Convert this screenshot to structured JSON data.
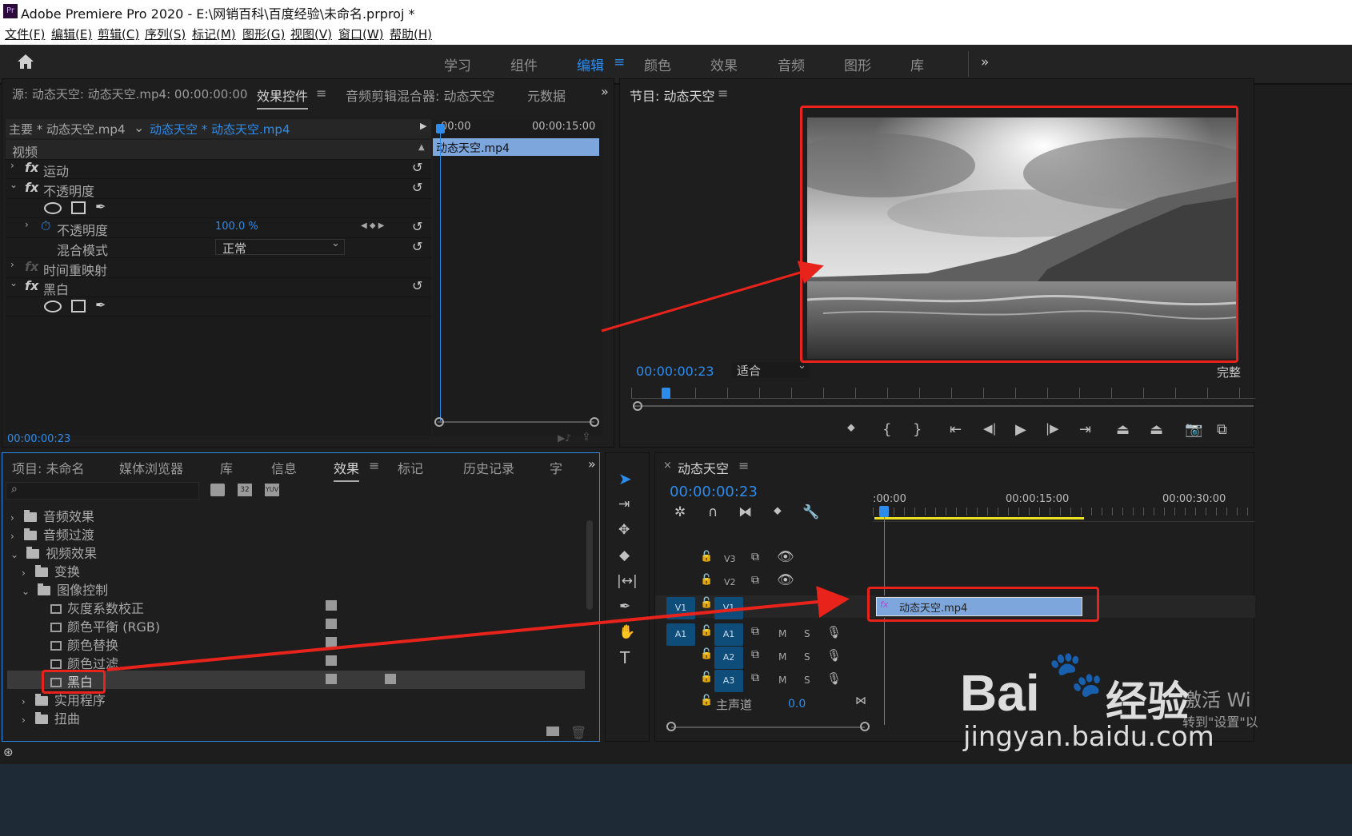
{
  "app": {
    "title": "Adobe Premiere Pro 2020 - E:\\网销百科\\百度经验\\未命名.prproj *",
    "pr_badge": "Pr"
  },
  "menu": [
    "文件(F)",
    "编辑(E)",
    "剪辑(C)",
    "序列(S)",
    "标记(M)",
    "图形(G)",
    "视图(V)",
    "窗口(W)",
    "帮助(H)"
  ],
  "workspaces": [
    "学习",
    "组件",
    "编辑",
    "颜色",
    "效果",
    "音频",
    "图形",
    "库"
  ],
  "active_workspace": "编辑",
  "source_panel": {
    "tabs": [
      "源: 动态天空: 动态天空.mp4: 00:00:00:00",
      "效果控件",
      "音频剪辑混合器: 动态天空",
      "元数据"
    ],
    "clip_master": "主要 * 动态天空.mp4",
    "clip_seq": "动态天空 * 动态天空.mp4",
    "section": "视频",
    "effects": [
      {
        "name": "运动"
      },
      {
        "name": "不透明度"
      },
      {
        "name": "不透明度",
        "value": "100.0 %"
      },
      {
        "name": "混合模式",
        "value": "正常"
      },
      {
        "name": "时间重映射"
      },
      {
        "name": "黑白"
      }
    ],
    "ruler": {
      "start": "00:00",
      "mid": "00:00:15:00"
    },
    "clip_label": "动态天空.mp4",
    "timecode": "00:00:00:23"
  },
  "program_panel": {
    "title": "节目: 动态天空",
    "timecode": "00:00:00:23",
    "fit": "适合",
    "quality": "完整"
  },
  "project_panel": {
    "tabs": [
      "项目: 未命名",
      "媒体浏览器",
      "库",
      "信息",
      "效果",
      "标记",
      "历史记录",
      "字"
    ],
    "tree": [
      {
        "label": "音频效果",
        "level": 0,
        "open": false
      },
      {
        "label": "音频过渡",
        "level": 0,
        "open": false
      },
      {
        "label": "视频效果",
        "level": 0,
        "open": true
      },
      {
        "label": "变换",
        "level": 1,
        "open": false
      },
      {
        "label": "图像控制",
        "level": 1,
        "open": true
      },
      {
        "label": "灰度系数校正",
        "level": 2
      },
      {
        "label": "颜色平衡 (RGB)",
        "level": 2
      },
      {
        "label": "颜色替换",
        "level": 2
      },
      {
        "label": "颜色过滤",
        "level": 2
      },
      {
        "label": "黑白",
        "level": 2,
        "selected": true
      },
      {
        "label": "实用程序",
        "level": 1,
        "open": false
      },
      {
        "label": "扭曲",
        "level": 1,
        "open": false
      }
    ]
  },
  "timeline": {
    "sequence": "动态天空",
    "timecode": "00:00:00:23",
    "ruler": [
      ":00:00",
      "00:00:15:00",
      "00:00:30:00"
    ],
    "tracks": [
      "V3",
      "V2",
      "V1",
      "A1",
      "A2",
      "A3"
    ],
    "master": "主声道",
    "master_value": "0.0",
    "clip_label": "动态天空.mp4",
    "mute": "M",
    "solo": "S"
  },
  "watermark": {
    "brand": "Bai",
    "brand2": "经验",
    "url": "jingyan.baidu.com",
    "activate": "激活 Wi",
    "activate2": "转到\"设置\"以"
  },
  "colors": {
    "accent": "#2d8ceb",
    "annotation": "#e8231b"
  }
}
